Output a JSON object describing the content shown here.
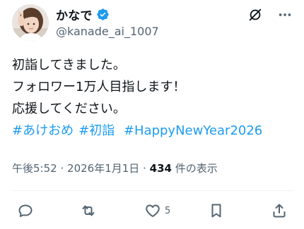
{
  "author": {
    "display_name": "かなで",
    "handle": "@kanade_ai_1007",
    "verified": true,
    "avatar": "profile-photo"
  },
  "post": {
    "lines": [
      "初詣してきました。",
      "フォロワー1万人目指します！",
      "応援してください。"
    ],
    "hashtags": [
      "#あけおめ",
      "#初詣",
      "#HappyNewYear2026"
    ]
  },
  "meta": {
    "time": "午後5:52",
    "separator1": "·",
    "date": "2026年1月1日",
    "separator2": "·",
    "views_count": "434",
    "views_label": "件の表示"
  },
  "actions": {
    "reply": {
      "icon": "reply-icon",
      "count": ""
    },
    "repost": {
      "icon": "repost-icon",
      "count": ""
    },
    "like": {
      "icon": "heart-icon",
      "count": "5"
    },
    "bookmark": {
      "icon": "bookmark-icon",
      "count": ""
    },
    "share": {
      "icon": "share-icon",
      "count": ""
    }
  },
  "colors": {
    "accent": "#1d9bf0",
    "text": "#0f1419",
    "muted": "#536471"
  }
}
